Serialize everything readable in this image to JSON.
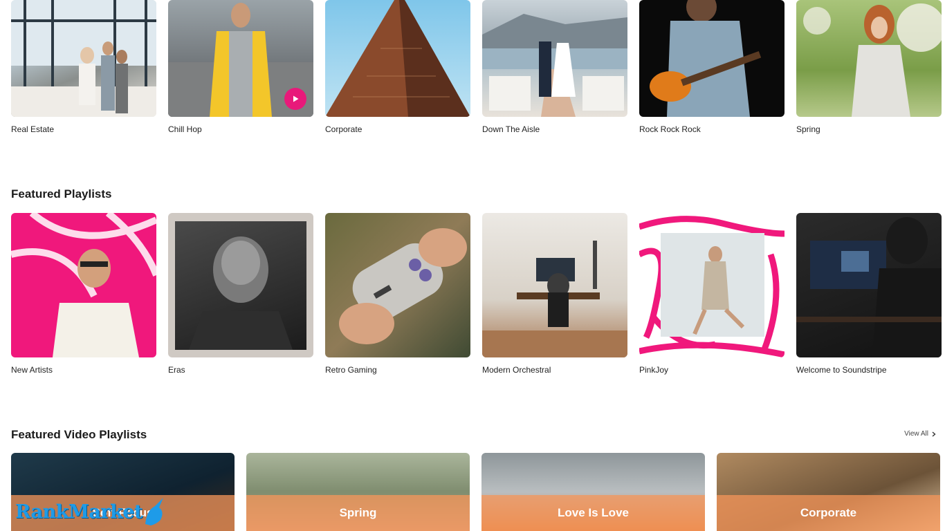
{
  "genres": {
    "items": [
      {
        "label": "Real Estate"
      },
      {
        "label": "Chill Hop"
      },
      {
        "label": "Corporate"
      },
      {
        "label": "Down The Aisle"
      },
      {
        "label": "Rock Rock Rock"
      },
      {
        "label": "Spring"
      }
    ]
  },
  "featured_playlists": {
    "title": "Featured Playlists",
    "items": [
      {
        "label": "New Artists"
      },
      {
        "label": "Eras"
      },
      {
        "label": "Retro Gaming"
      },
      {
        "label": "Modern Orchestral"
      },
      {
        "label": "PinkJoy"
      },
      {
        "label": "Welcome to Soundstripe"
      }
    ]
  },
  "featured_video_playlists": {
    "title": "Featured Video Playlists",
    "view_all": "View All",
    "items": [
      {
        "title": "Soft Focus"
      },
      {
        "title": "Spring"
      },
      {
        "title": "Love Is Love"
      },
      {
        "title": "Corporate"
      }
    ]
  },
  "watermark": {
    "text": "RankMarket"
  },
  "colors": {
    "accent": "#e8197a",
    "band": "#f5965a",
    "watermark": "#1e9be8"
  },
  "icons": {
    "play": "play-icon",
    "chevron": "chevron-right-icon"
  }
}
